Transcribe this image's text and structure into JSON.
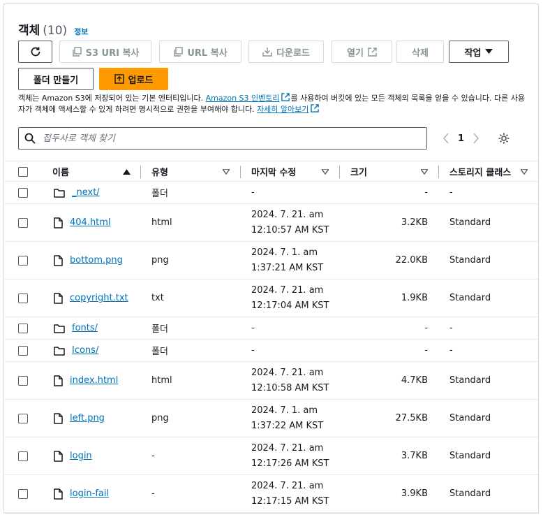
{
  "header": {
    "title": "객체",
    "count": "(10)",
    "info": "정보"
  },
  "toolbar": {
    "copy_s3_uri": "S3 URI 복사",
    "copy_url": "URL 복사",
    "download": "다운로드",
    "open": "열기",
    "delete": "삭제",
    "actions": "작업",
    "create_folder": "폴더 만들기",
    "upload": "업로드"
  },
  "description": {
    "part1": "객체는 Amazon S3에 저장되어 있는 기본 엔터티입니다. ",
    "link1": "Amazon S3 인벤토리",
    "part2": "를 사용하여 버킷에 있는 모든 객체의 목록을 얻을 수 있습니다. 다른 사용자가 객체에 액세스할 수 있게 하려면 명시적으로 권한을 부여해야 합니다. ",
    "link2": "자세히 알아보기"
  },
  "search": {
    "placeholder": "접두사로 객체 찾기"
  },
  "pagination": {
    "current": "1"
  },
  "table": {
    "columns": {
      "name": "이름",
      "type": "유형",
      "modified": "마지막 수정",
      "size": "크기",
      "storage": "스토리지 클래스"
    },
    "rows": [
      {
        "name": "_next/",
        "kind": "folder",
        "type": "폴더",
        "date1": "-",
        "date2": "",
        "size": "-",
        "storage": "-"
      },
      {
        "name": "404.html",
        "kind": "file",
        "type": "html",
        "date1": "2024. 7. 21. am",
        "date2": "12:10:57 AM KST",
        "size": "3.2KB",
        "storage": "Standard"
      },
      {
        "name": "bottom.png",
        "kind": "file",
        "type": "png",
        "date1": "2024. 7. 1. am",
        "date2": "1:37:21 AM KST",
        "size": "22.0KB",
        "storage": "Standard"
      },
      {
        "name": "copyright.txt",
        "kind": "file",
        "type": "txt",
        "date1": "2024. 7. 21. am",
        "date2": "12:17:04 AM KST",
        "size": "1.9KB",
        "storage": "Standard"
      },
      {
        "name": "fonts/",
        "kind": "folder",
        "type": "폴더",
        "date1": "-",
        "date2": "",
        "size": "-",
        "storage": "-"
      },
      {
        "name": "Icons/",
        "kind": "folder",
        "type": "폴더",
        "date1": "-",
        "date2": "",
        "size": "-",
        "storage": "-"
      },
      {
        "name": "index.html",
        "kind": "file",
        "type": "html",
        "date1": "2024. 7. 21. am",
        "date2": "12:10:58 AM KST",
        "size": "4.7KB",
        "storage": "Standard"
      },
      {
        "name": "left.png",
        "kind": "file",
        "type": "png",
        "date1": "2024. 7. 1. am",
        "date2": "1:37:22 AM KST",
        "size": "27.5KB",
        "storage": "Standard"
      },
      {
        "name": "login",
        "kind": "file",
        "type": "-",
        "date1": "2024. 7. 21. am",
        "date2": "12:17:26 AM KST",
        "size": "3.7KB",
        "storage": "Standard"
      },
      {
        "name": "login-fail",
        "kind": "file",
        "type": "-",
        "date1": "2024. 7. 21. am",
        "date2": "12:17:15 AM KST",
        "size": "3.9KB",
        "storage": "Standard"
      }
    ]
  },
  "colors": {
    "link": "#0073bb",
    "primary": "#ff9900",
    "border": "#545b64",
    "disabled": "#879596"
  }
}
